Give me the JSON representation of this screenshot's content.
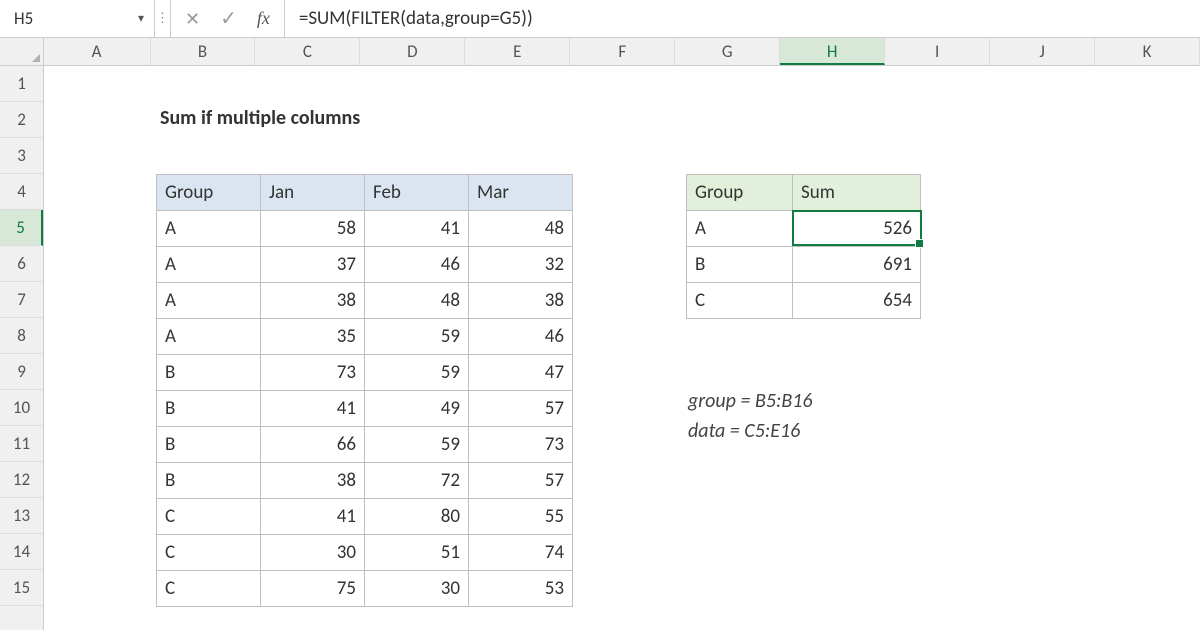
{
  "formula_bar": {
    "cell_ref": "H5",
    "fx_label": "fx",
    "formula": "=SUM(FILTER(data,group=G5))"
  },
  "columns": [
    "A",
    "B",
    "C",
    "D",
    "E",
    "F",
    "G",
    "H",
    "I",
    "J",
    "K"
  ],
  "active_col": "H",
  "rows": [
    1,
    2,
    3,
    4,
    5,
    6,
    7,
    8,
    9,
    10,
    11,
    12,
    13,
    14,
    15
  ],
  "active_row": 5,
  "sheet_title": "Sum if multiple columns",
  "data_headers": {
    "group": "Group",
    "c1": "Jan",
    "c2": "Feb",
    "c3": "Mar"
  },
  "data_rows": [
    {
      "g": "A",
      "v1": 58,
      "v2": 41,
      "v3": 48
    },
    {
      "g": "A",
      "v1": 37,
      "v2": 46,
      "v3": 32
    },
    {
      "g": "A",
      "v1": 38,
      "v2": 48,
      "v3": 38
    },
    {
      "g": "A",
      "v1": 35,
      "v2": 59,
      "v3": 46
    },
    {
      "g": "B",
      "v1": 73,
      "v2": 59,
      "v3": 47
    },
    {
      "g": "B",
      "v1": 41,
      "v2": 49,
      "v3": 57
    },
    {
      "g": "B",
      "v1": 66,
      "v2": 59,
      "v3": 73
    },
    {
      "g": "B",
      "v1": 38,
      "v2": 72,
      "v3": 57
    },
    {
      "g": "C",
      "v1": 41,
      "v2": 80,
      "v3": 55
    },
    {
      "g": "C",
      "v1": 30,
      "v2": 51,
      "v3": 74
    },
    {
      "g": "C",
      "v1": 75,
      "v2": 30,
      "v3": 53
    }
  ],
  "summary_headers": {
    "group": "Group",
    "sum": "Sum"
  },
  "summary_rows": [
    {
      "g": "A",
      "s": 526
    },
    {
      "g": "B",
      "s": 691
    },
    {
      "g": "C",
      "s": 654
    }
  ],
  "notes": {
    "line1": "group = B5:B16",
    "line2": "data = C5:E16"
  }
}
